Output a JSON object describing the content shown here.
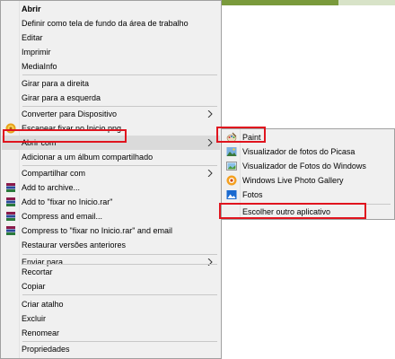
{
  "colors": {
    "menu_bg": "#f0f0f0",
    "hover_bg": "#dadada",
    "highlight_box": "#e0141e"
  },
  "main_menu": {
    "abrir": "Abrir",
    "wallpaper": "Definir como tela de fundo da área de trabalho",
    "editar": "Editar",
    "imprimir": "Imprimir",
    "mediainfo": "MediaInfo",
    "girar_direita": "Girar para a direita",
    "girar_esquerda": "Girar para a esquerda",
    "converter": "Converter para Dispositivo",
    "escanear": "Escanear fixar no Inicio.png",
    "abrir_com": "Abrir com",
    "adicionar_album": "Adicionar a um álbum compartilhado",
    "compartilhar": "Compartilhar com",
    "add_archive": "Add to archive...",
    "add_rar": "Add to \"fixar no Inicio.rar\"",
    "compress_email": "Compress and email...",
    "compress_rar_email": "Compress to \"fixar no Inicio.rar\" and email",
    "restaurar": "Restaurar versões anteriores",
    "enviar": "Enviar para",
    "recortar": "Recortar",
    "copiar": "Copiar",
    "criar_atalho": "Criar atalho",
    "excluir": "Excluir",
    "renomear": "Renomear",
    "propriedades": "Propriedades"
  },
  "sub_menu": {
    "paint": "Paint",
    "picasa": "Visualizador de fotos do Picasa",
    "windows_viewer": "Visualizador de Fotos do Windows",
    "live_gallery": "Windows Live Photo Gallery",
    "fotos": "Fotos",
    "escolher": "Escolher outro aplicativo"
  },
  "icons": {
    "escanear": "shield-scan-icon",
    "winrar": "winrar-books-icon",
    "paint": "paint-palette-icon",
    "picasa": "picasa-icon",
    "windows_viewer": "photo-viewer-icon",
    "live_gallery": "live-gallery-icon",
    "fotos": "photos-app-icon",
    "submenu_arrow": "chevron-right-icon"
  }
}
